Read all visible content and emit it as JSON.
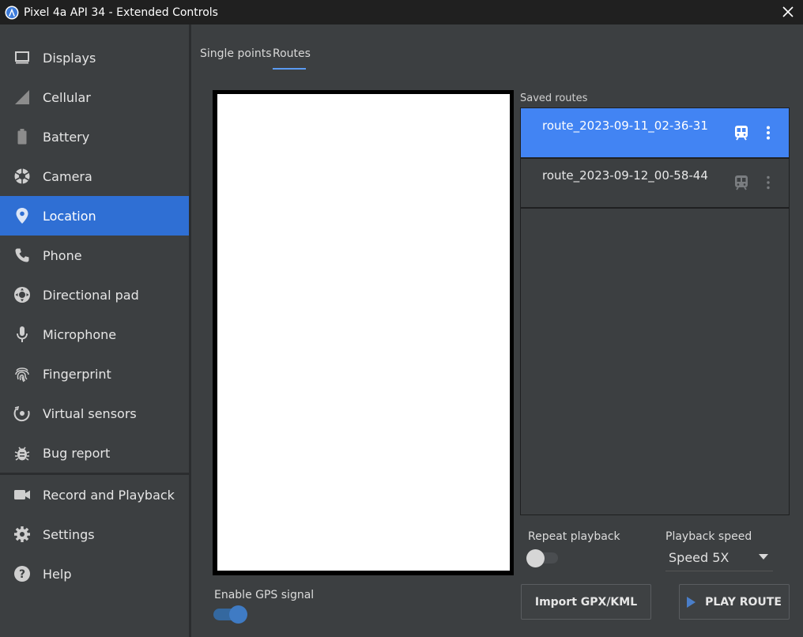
{
  "window": {
    "title": "Pixel 4a API 34 - Extended Controls"
  },
  "sidebar": {
    "items": [
      {
        "label": "Displays",
        "icon": "displays-icon"
      },
      {
        "label": "Cellular",
        "icon": "cellular-icon"
      },
      {
        "label": "Battery",
        "icon": "battery-icon"
      },
      {
        "label": "Camera",
        "icon": "camera-icon"
      },
      {
        "label": "Location",
        "icon": "location-icon",
        "active": true
      },
      {
        "label": "Phone",
        "icon": "phone-icon"
      },
      {
        "label": "Directional pad",
        "icon": "dpad-icon"
      },
      {
        "label": "Microphone",
        "icon": "microphone-icon"
      },
      {
        "label": "Fingerprint",
        "icon": "fingerprint-icon"
      },
      {
        "label": "Virtual sensors",
        "icon": "virtual-sensors-icon"
      },
      {
        "label": "Bug report",
        "icon": "bug-icon"
      },
      {
        "label": "Record and Playback",
        "icon": "record-icon"
      },
      {
        "label": "Settings",
        "icon": "gear-icon"
      },
      {
        "label": "Help",
        "icon": "help-icon"
      }
    ]
  },
  "tabs": [
    {
      "label": "Single points"
    },
    {
      "label": "Routes",
      "active": true
    }
  ],
  "saved_routes": {
    "label": "Saved routes",
    "routes": [
      {
        "name": "route_2023-09-11_02-36-31",
        "selected": true
      },
      {
        "name": "route_2023-09-12_00-58-44",
        "selected": false
      }
    ]
  },
  "repeat_playback": {
    "label": "Repeat playback",
    "on": false
  },
  "playback_speed": {
    "label": "Playback speed",
    "value": "Speed 5X"
  },
  "gps": {
    "label": "Enable GPS signal",
    "on": true
  },
  "buttons": {
    "import": "Import GPX/KML",
    "play": "PLAY ROUTE"
  },
  "colors": {
    "accent": "#2f6fd4",
    "selected_route": "#4284f3",
    "background": "#3c3f41",
    "titlebar": "#202020"
  }
}
